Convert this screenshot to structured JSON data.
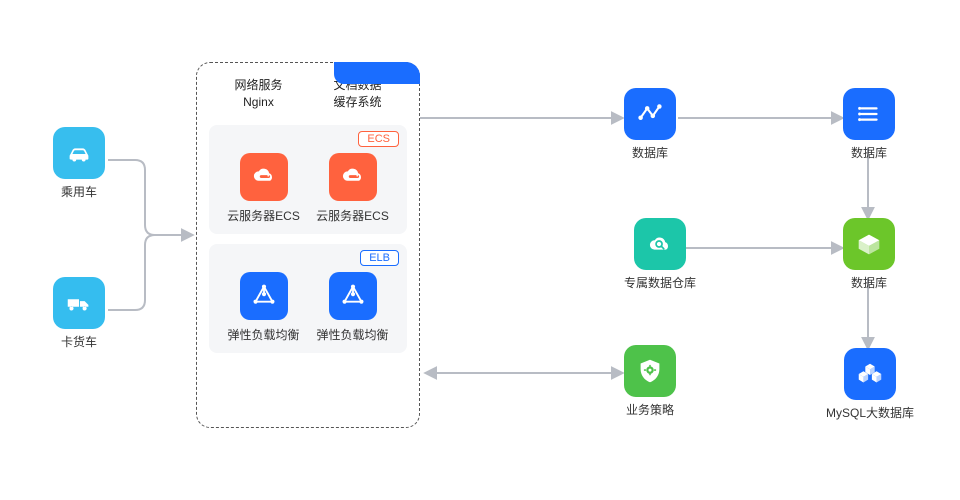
{
  "left": {
    "car_label": "乘用车",
    "truck_label": "卡货车"
  },
  "panel": {
    "header_left_line1": "网络服务",
    "header_left_line2": "Nginx",
    "header_right_line1": "文档数据",
    "header_right_line2": "缓存系统",
    "ecs_badge": "ECS",
    "ecs_item_label": "云服务器ECS",
    "elb_badge": "ELB",
    "elb_item_label": "弹性负载均衡"
  },
  "right": {
    "top_left_label": "数据库",
    "top_right_label": "数据库",
    "mid_left_label": "专属数据仓库",
    "mid_right_label": "数据库",
    "bot_left_label": "业务策略",
    "bot_right_label": "MySQL大数据库"
  },
  "colors": {
    "car": "#37beee",
    "truck": "#35bdef",
    "ecs": "#ff623e",
    "elb": "#1a6dff",
    "graph": "#1a6dff",
    "graph2": "#1a6dff",
    "cloud_search": "#1cc6a9",
    "cube_green": "#6cc62a",
    "shield": "#4ec24a",
    "cubes": "#1a6dff"
  }
}
